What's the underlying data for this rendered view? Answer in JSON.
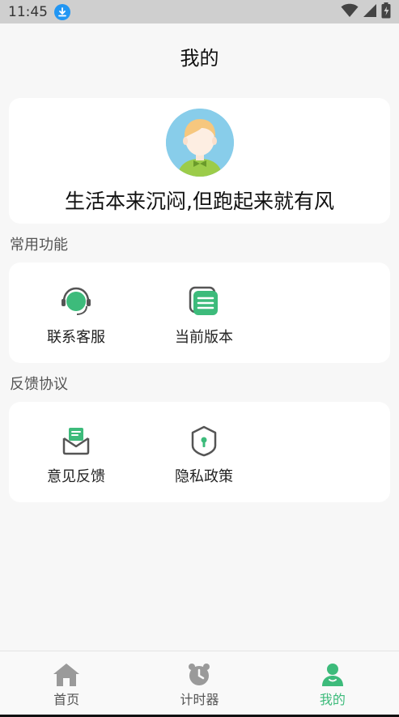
{
  "status_bar": {
    "time": "11:45"
  },
  "header": {
    "title": "我的"
  },
  "profile": {
    "motto": "生活本来沉闷,但跑起来就有风"
  },
  "common_functions": {
    "title": "常用功能",
    "items": [
      {
        "label": "联系客服",
        "icon": "headset-icon"
      },
      {
        "label": "当前版本",
        "icon": "version-list-icon"
      }
    ]
  },
  "feedback_agreement": {
    "title": "反馈协议",
    "items": [
      {
        "label": "意见反馈",
        "icon": "feedback-envelope-icon"
      },
      {
        "label": "隐私政策",
        "icon": "privacy-shield-icon"
      }
    ]
  },
  "bottom_nav": {
    "items": [
      {
        "label": "首页",
        "icon": "home-icon",
        "active": false
      },
      {
        "label": "计时器",
        "icon": "alarm-clock-icon",
        "active": false
      },
      {
        "label": "我的",
        "icon": "user-icon",
        "active": true
      }
    ]
  },
  "colors": {
    "accent": "#3dbb7b",
    "inactive_icon": "#9a9a9a",
    "background": "#f7f7f7",
    "card": "#ffffff"
  }
}
